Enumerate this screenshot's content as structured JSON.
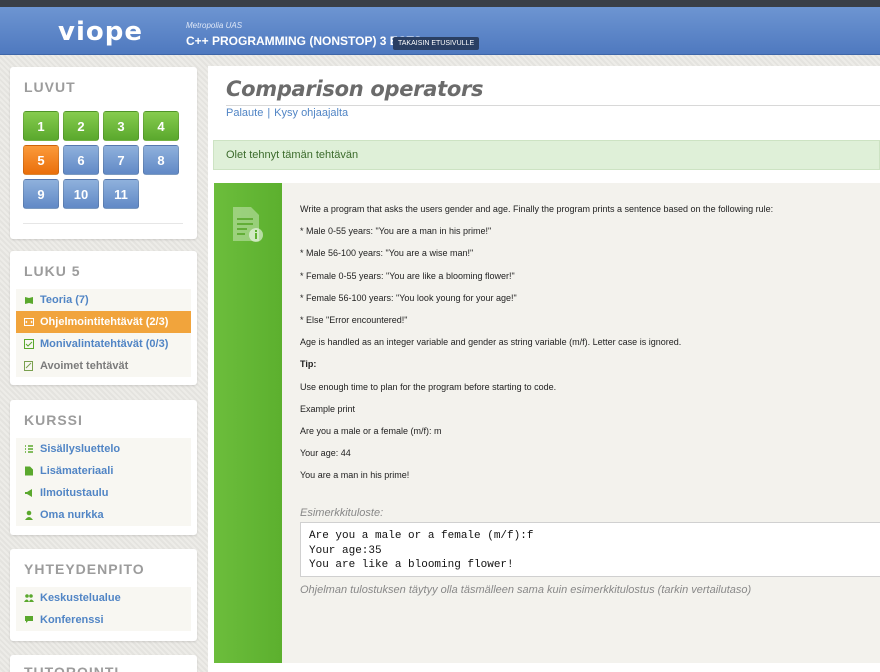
{
  "header": {
    "logo": "viope",
    "organization": "Metropolia UAS",
    "course_title": "C++ PROGRAMMING (NONSTOP) 3 ECTS",
    "back_button": "TAKAISIN ETUSIVULLE"
  },
  "chapters": {
    "title": "LUVUT",
    "items": [
      "1",
      "2",
      "3",
      "4",
      "5",
      "6",
      "7",
      "8",
      "9",
      "10",
      "11"
    ],
    "active": "5"
  },
  "chapter_menu": {
    "title": "LUKU 5",
    "items": [
      {
        "label": "Teoria (7)",
        "icon": "book-icon"
      },
      {
        "label": "Ohjelmointitehtävät (2/3)",
        "icon": "code-icon"
      },
      {
        "label": "Monivalintatehtävät (0/3)",
        "icon": "checklist-icon"
      },
      {
        "label": "Avoimet tehtävät",
        "icon": "edit-icon"
      }
    ]
  },
  "course_menu": {
    "title": "KURSSI",
    "items": [
      {
        "label": "Sisällysluettelo",
        "icon": "list-icon"
      },
      {
        "label": "Lisämateriaali",
        "icon": "document-icon"
      },
      {
        "label": "Ilmoitustaulu",
        "icon": "megaphone-icon"
      },
      {
        "label": "Oma nurkka",
        "icon": "user-icon"
      }
    ]
  },
  "contact_menu": {
    "title": "YHTEYDENPITO",
    "items": [
      {
        "label": "Keskustelualue",
        "icon": "people-icon"
      },
      {
        "label": "Konferenssi",
        "icon": "chat-icon"
      }
    ]
  },
  "tutoring": {
    "title": "TUTOROINTI"
  },
  "main": {
    "title": "Comparison operators",
    "link_feedback": "Palaute",
    "link_separator": "|",
    "link_ask": "Kysy ohjaajalta",
    "done_message": "Olet tehnyt tämän tehtävän",
    "task_lines": [
      "Write a program that asks the users gender and age. Finally the program prints a sentence based on the following rule:",
      "* Male 0-55 years: \"You are a man in his prime!\"",
      "* Male 56-100 years: \"You are a wise man!\"",
      "* Female 0-55 years: \"You are like a blooming flower!\"",
      "* Female 56-100 years: \"You look young for your age!\"",
      "* Else \"Error encountered!\"",
      "Age is handled as an integer variable and gender as string variable (m/f). Letter case is ignored.",
      "Tip:",
      "Use enough time to plan for the program before starting to code.",
      "Example print",
      "Are you a male or a female (m/f): m",
      "Your age: 44",
      "You are a man in his prime!"
    ],
    "example_label": "Esimerkkituloste:",
    "example_output": [
      "Are you a male or a female (m/f):f",
      "Your age:35",
      "You are like a blooming flower!"
    ],
    "output_note": "Ohjelman tulostuksen täytyy olla täsmälleen sama kuin esimerkkitulostus (tarkin vertailutaso)"
  },
  "colors": {
    "header_blue": "#5a84c8",
    "chapter_green": "#6cbd3c",
    "chapter_blue": "#7aa0d4",
    "chapter_active": "#f38321",
    "menu_active": "#f1a43c",
    "link_blue": "#5185c5",
    "done_bg": "#dff0d8"
  }
}
